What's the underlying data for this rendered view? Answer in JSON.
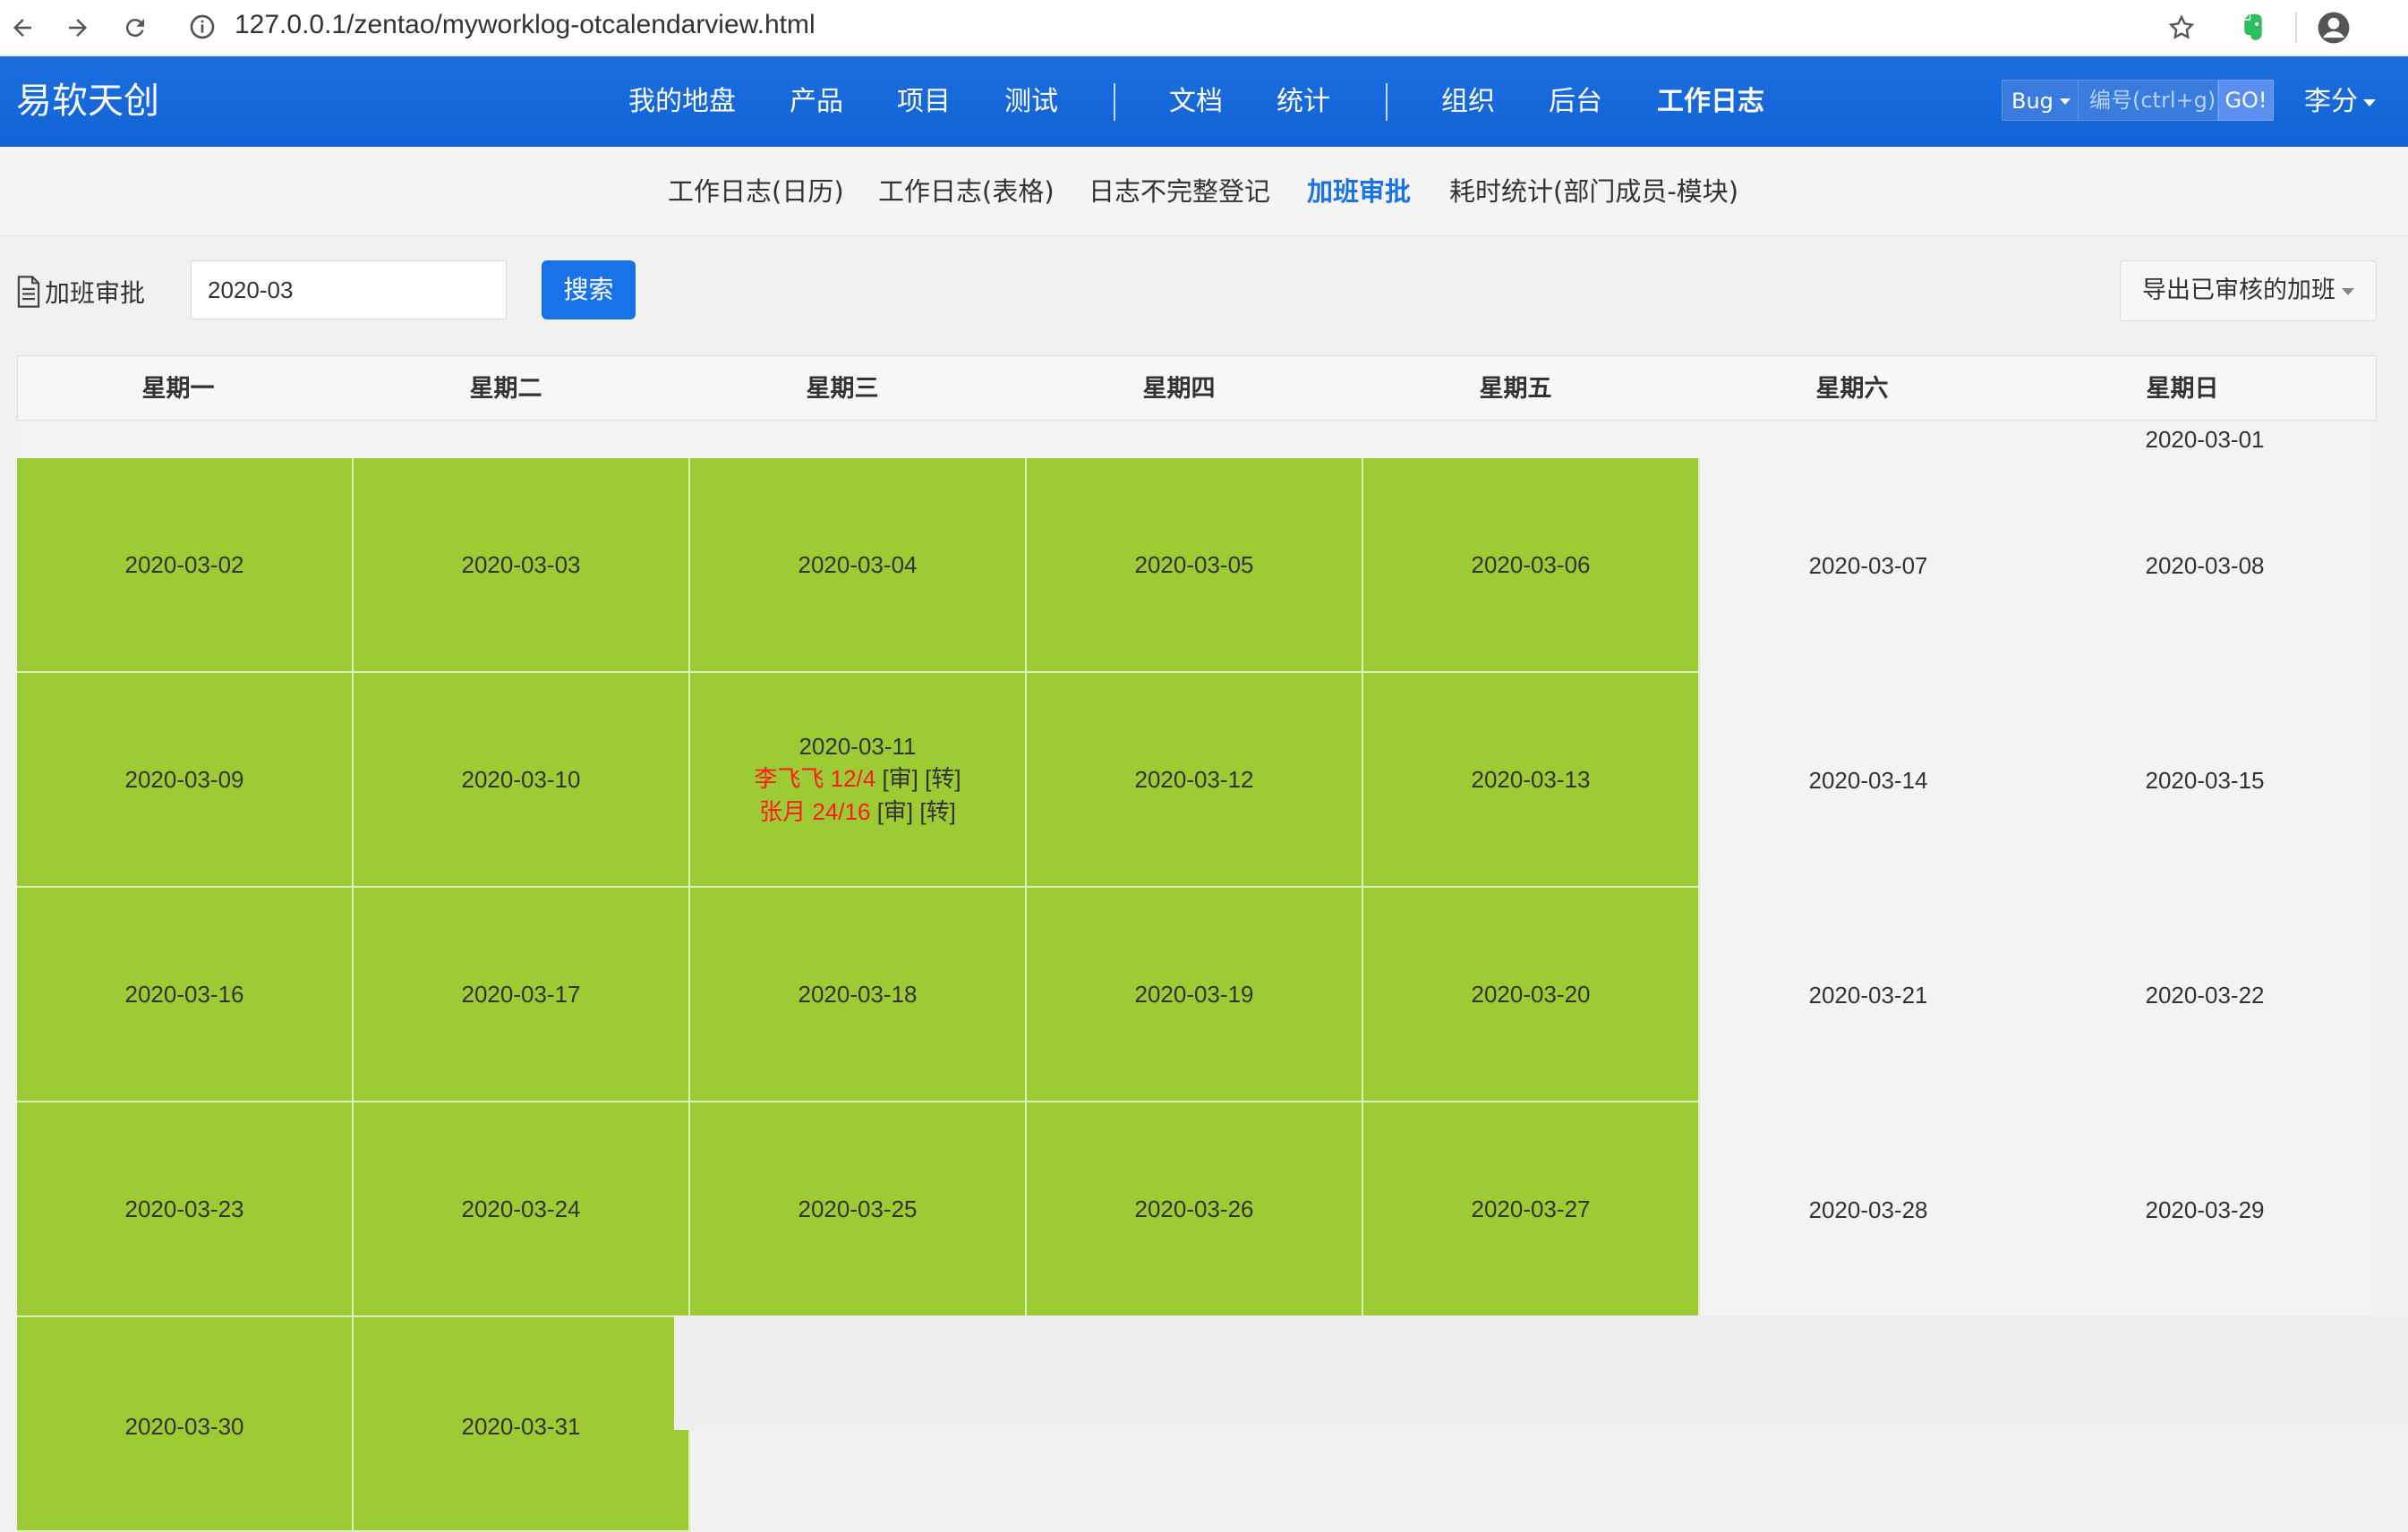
{
  "browser": {
    "url": "127.0.0.1/zentao/myworklog-otcalendarview.html"
  },
  "header": {
    "brand": "易软天创",
    "nav": [
      {
        "label": "我的地盘"
      },
      {
        "label": "产品"
      },
      {
        "label": "项目"
      },
      {
        "label": "测试"
      },
      {
        "label": "文档"
      },
      {
        "label": "统计"
      },
      {
        "label": "组织"
      },
      {
        "label": "后台"
      },
      {
        "label": "工作日志",
        "active": true
      }
    ],
    "quick_select": "Bug",
    "quick_placeholder": "编号(ctrl+g)",
    "go_label": "GO!",
    "user": "李分"
  },
  "subnav": [
    {
      "label": "工作日志(日历)"
    },
    {
      "label": "工作日志(表格)"
    },
    {
      "label": "日志不完整登记"
    },
    {
      "label": "加班审批",
      "active": true
    },
    {
      "label": "耗时统计(部门成员-模块)"
    }
  ],
  "toolbar": {
    "title": "加班审批",
    "month_value": "2020-03",
    "search_label": "搜索",
    "export_label": "导出已审核的加班"
  },
  "calendar": {
    "weekdays": [
      "星期一",
      "星期二",
      "星期三",
      "星期四",
      "星期五",
      "星期六",
      "星期日"
    ],
    "first_row_date": "2020-03-01",
    "weeks": [
      [
        "2020-03-02",
        "2020-03-03",
        "2020-03-04",
        "2020-03-05",
        "2020-03-06",
        "2020-03-07",
        "2020-03-08"
      ],
      [
        "2020-03-09",
        "2020-03-10",
        "2020-03-11",
        "2020-03-12",
        "2020-03-13",
        "2020-03-14",
        "2020-03-15"
      ],
      [
        "2020-03-16",
        "2020-03-17",
        "2020-03-18",
        "2020-03-19",
        "2020-03-20",
        "2020-03-21",
        "2020-03-22"
      ],
      [
        "2020-03-23",
        "2020-03-24",
        "2020-03-25",
        "2020-03-26",
        "2020-03-27",
        "2020-03-28",
        "2020-03-29"
      ],
      [
        "2020-03-30",
        "2020-03-31"
      ]
    ],
    "overtime_day": "2020-03-11",
    "overtime_entries": [
      {
        "person": "李飞飞 12/4",
        "approve": "[审]",
        "transfer": "[转]"
      },
      {
        "person": "张月 24/16",
        "approve": "[审]",
        "transfer": "[转]"
      }
    ],
    "workday_color": "#9dcb34"
  }
}
